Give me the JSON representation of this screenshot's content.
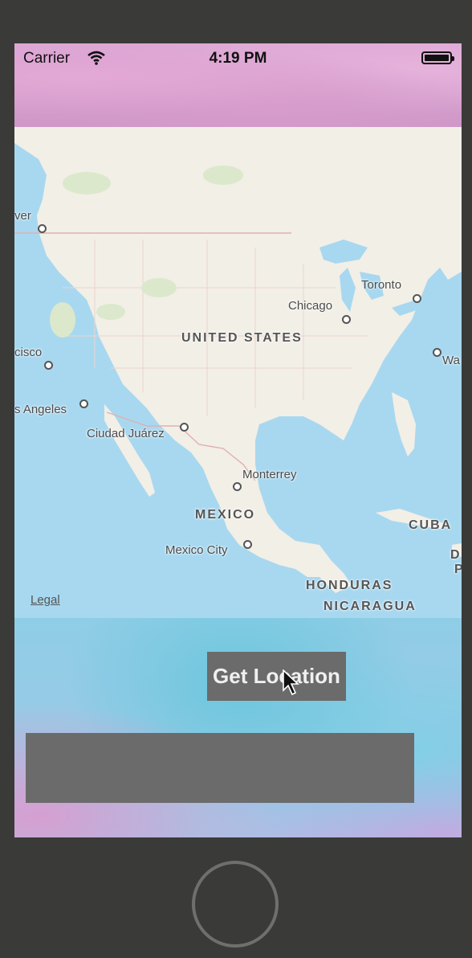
{
  "status_bar": {
    "carrier": "Carrier",
    "time": "4:19 PM",
    "wifi_icon": "wifi-icon",
    "battery_icon": "battery-icon"
  },
  "map": {
    "legal_label": "Legal",
    "labels": {
      "toronto": "Toronto",
      "chicago": "Chicago",
      "united_states": "UNITED STATES",
      "san_francisco": "cisco",
      "vancouver": "ver",
      "los_angeles": "s Angeles",
      "ciudad_juarez": "Ciudad Juárez",
      "monterrey": "Monterrey",
      "mexico": "MEXICO",
      "mexico_city": "Mexico City",
      "cuba": "CUBA",
      "honduras": "HONDURAS",
      "nicaragua": "NICARAGUA",
      "washington": "Wa",
      "dominican": "D",
      "puerto_rico": "P"
    }
  },
  "actions": {
    "get_location_label": "Get Location",
    "result_text": ""
  },
  "colors": {
    "water": "#a8d8f0",
    "land": "#f2efe6",
    "button_bg": "#6b6b6b",
    "device_frame": "#3a3a38"
  }
}
